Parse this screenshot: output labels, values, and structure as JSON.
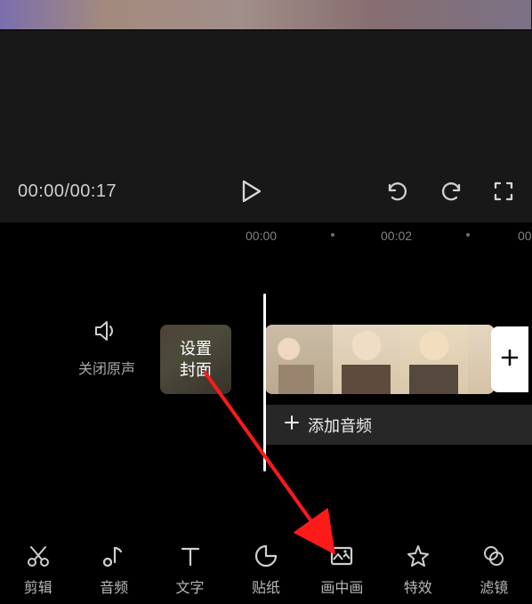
{
  "preview": {
    "time_label": "00:00/00:17"
  },
  "ruler": {
    "ticks": [
      "00:00",
      "00:02",
      "00"
    ]
  },
  "timeline": {
    "mute_label": "关闭原声",
    "cover_label": "设置\n封面",
    "add_audio_label": "添加音频"
  },
  "toolbar": {
    "items": [
      {
        "label": "剪辑"
      },
      {
        "label": "音频"
      },
      {
        "label": "文字"
      },
      {
        "label": "贴纸"
      },
      {
        "label": "画中画"
      },
      {
        "label": "特效"
      },
      {
        "label": "滤镜"
      }
    ]
  }
}
